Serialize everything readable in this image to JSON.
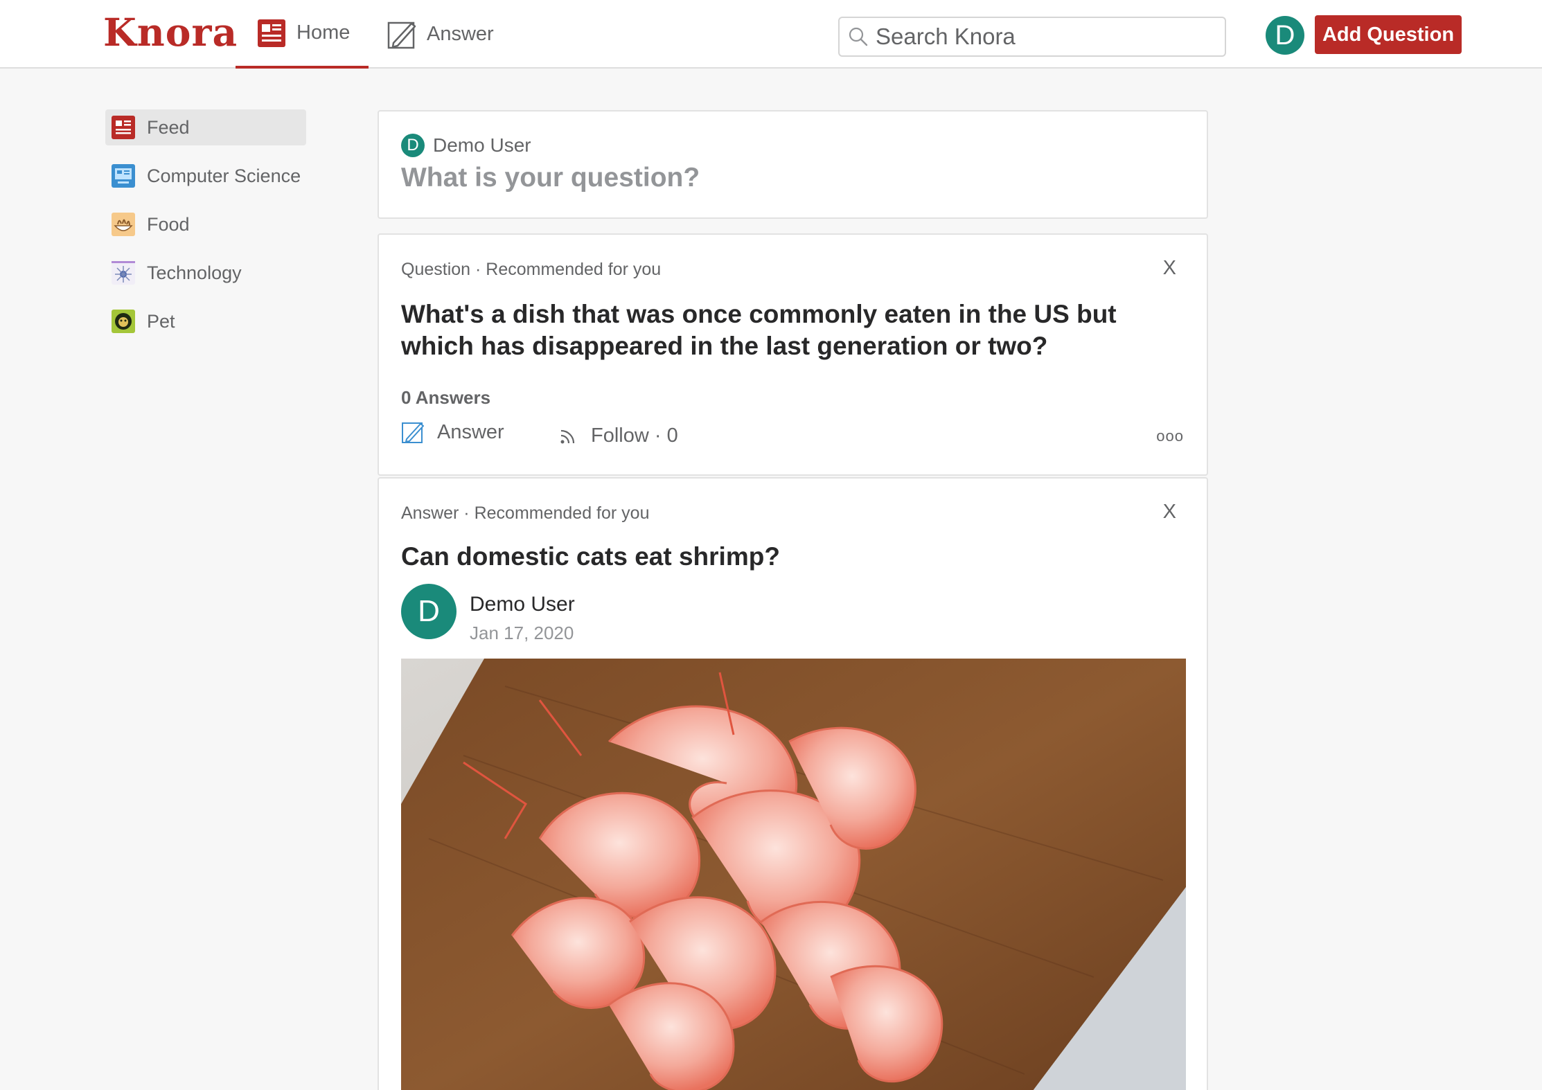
{
  "header": {
    "logo": "Knora",
    "nav": {
      "home_label": "Home",
      "answer_label": "Answer"
    },
    "search": {
      "placeholder": "Search Knora"
    },
    "avatar_letter": "D",
    "add_question_label": "Add Question"
  },
  "sidebar": {
    "items": [
      {
        "label": "Feed",
        "icon": "feed-icon",
        "active": true
      },
      {
        "label": "Computer Science",
        "icon": "computer-science-icon"
      },
      {
        "label": "Food",
        "icon": "food-icon"
      },
      {
        "label": "Technology",
        "icon": "technology-icon"
      },
      {
        "label": "Pet",
        "icon": "pet-icon"
      }
    ]
  },
  "ask_box": {
    "avatar_letter": "D",
    "user_name": "Demo User",
    "prompt": "What is your question?"
  },
  "question_card": {
    "meta": "Question · Recommended for you",
    "close": "X",
    "title": "What's a dish that was once commonly eaten in the US but which has disappeared in the last generation or two?",
    "answers_count": "0 Answers",
    "answer_label": "Answer",
    "follow_label": "Follow · 0",
    "more": "ooo"
  },
  "answer_card": {
    "meta": "Answer · Recommended for you",
    "close": "X",
    "title": "Can domestic cats eat shrimp?",
    "avatar_letter": "D",
    "author": "Demo User",
    "date": "Jan 17, 2020",
    "image_icon": "shrimp-photo"
  },
  "colors": {
    "brand": "#b92b27",
    "avatar": "#1a8a7a",
    "background": "#f7f7f7"
  }
}
